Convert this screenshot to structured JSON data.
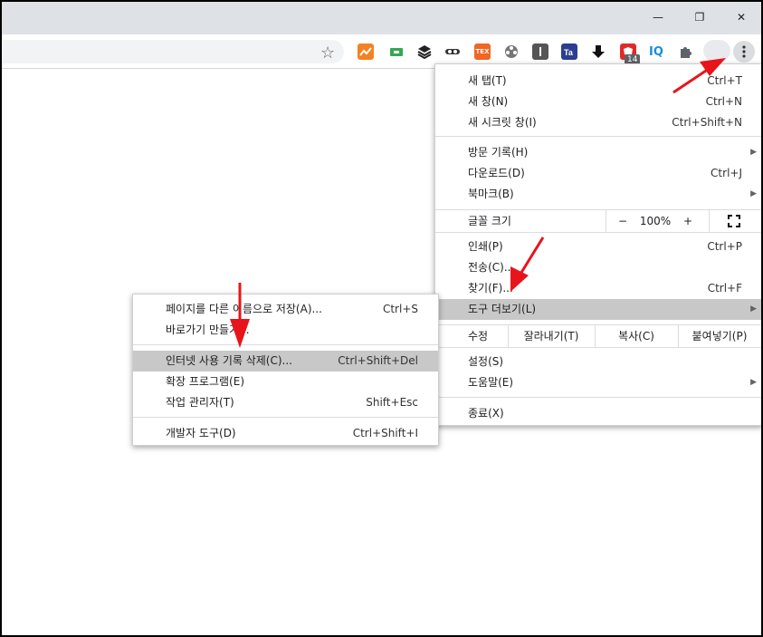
{
  "window": {
    "minimize_glyph": "—",
    "restore_glyph": "❐",
    "close_glyph": "✕"
  },
  "extensions": {
    "badge_count": "14",
    "iq_label": "IQ",
    "tex_label": "TEX"
  },
  "main_menu": {
    "items_1": [
      {
        "label": "새 탭(T)",
        "shortcut": "Ctrl+T"
      },
      {
        "label": "새 창(N)",
        "shortcut": "Ctrl+N"
      },
      {
        "label": "새 시크릿 창(I)",
        "shortcut": "Ctrl+Shift+N"
      }
    ],
    "items_2": [
      {
        "label": "방문 기록(H)",
        "arrow": "▶"
      },
      {
        "label": "다운로드(D)",
        "shortcut": "Ctrl+J"
      },
      {
        "label": "북마크(B)",
        "arrow": "▶"
      }
    ],
    "zoom": {
      "label": "글꼴 크기",
      "minus": "−",
      "value": "100%",
      "plus": "+",
      "fullscreen_glyph": "⛶"
    },
    "items_3": [
      {
        "label": "인쇄(P)",
        "shortcut": "Ctrl+P"
      },
      {
        "label": "전송(C)...",
        "shortcut": ""
      },
      {
        "label": "찾기(F)...",
        "shortcut": "Ctrl+F"
      },
      {
        "label": "도구 더보기(L)",
        "arrow": "▶"
      }
    ],
    "edit": {
      "label": "수정",
      "cut": "잘라내기(T)",
      "copy": "복사(C)",
      "paste": "붙여넣기(P)"
    },
    "items_4": [
      {
        "label": "설정(S)"
      },
      {
        "label": "도움말(E)",
        "arrow": "▶"
      }
    ],
    "exit": {
      "label": "종료(X)"
    }
  },
  "more_tools_menu": {
    "items_1": [
      {
        "label": "페이지를 다른 이름으로 저장(A)...",
        "shortcut": "Ctrl+S"
      },
      {
        "label": "바로가기 만들기...",
        "shortcut": ""
      }
    ],
    "items_2": [
      {
        "label": "인터넷 사용 기록 삭제(C)...",
        "shortcut": "Ctrl+Shift+Del"
      },
      {
        "label": "확장 프로그램(E)",
        "shortcut": ""
      },
      {
        "label": "작업 관리자(T)",
        "shortcut": "Shift+Esc"
      }
    ],
    "items_3": [
      {
        "label": "개발자 도구(D)",
        "shortcut": "Ctrl+Shift+I"
      }
    ]
  },
  "colors": {
    "arrow": "#e8141b",
    "highlight": "#c8c8c8"
  }
}
